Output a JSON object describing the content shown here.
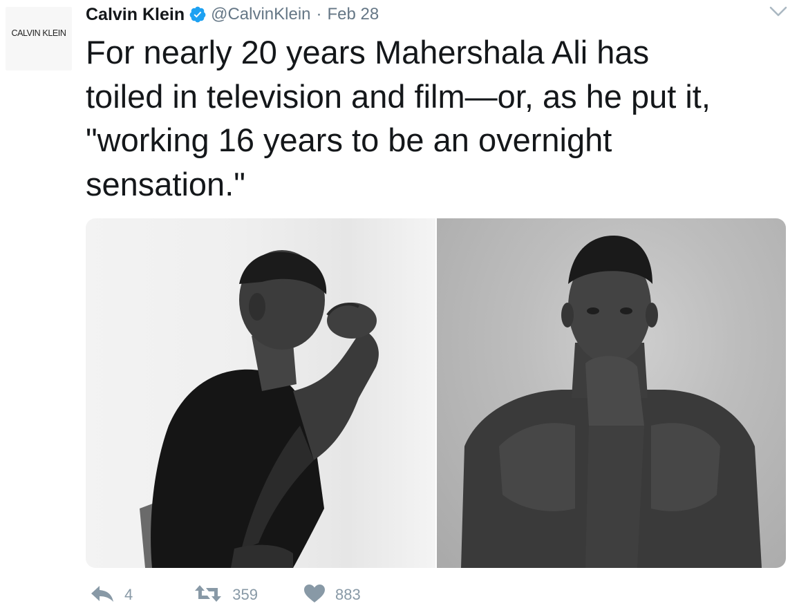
{
  "tweet": {
    "avatar_text": "CALVIN KLEIN",
    "display_name": "Calvin Klein",
    "handle": "@CalvinKlein",
    "separator": "·",
    "date": "Feb 28",
    "text": "For nearly 20 years Mahershala Ali has\ntoiled in television and film—or, as he put it,\n\"working 16 years to be an overnight\nsensation.\"",
    "verified_color": "#1da1f2",
    "media": [
      {
        "icon": "photo-man-in-tshirt-profile"
      },
      {
        "icon": "photo-man-shirtless-portrait"
      }
    ],
    "actions": {
      "reply_count": "4",
      "retweet_count": "359",
      "like_count": "883"
    }
  },
  "colors": {
    "text": "#14171a",
    "secondary": "#657786",
    "action": "#8899a6"
  }
}
